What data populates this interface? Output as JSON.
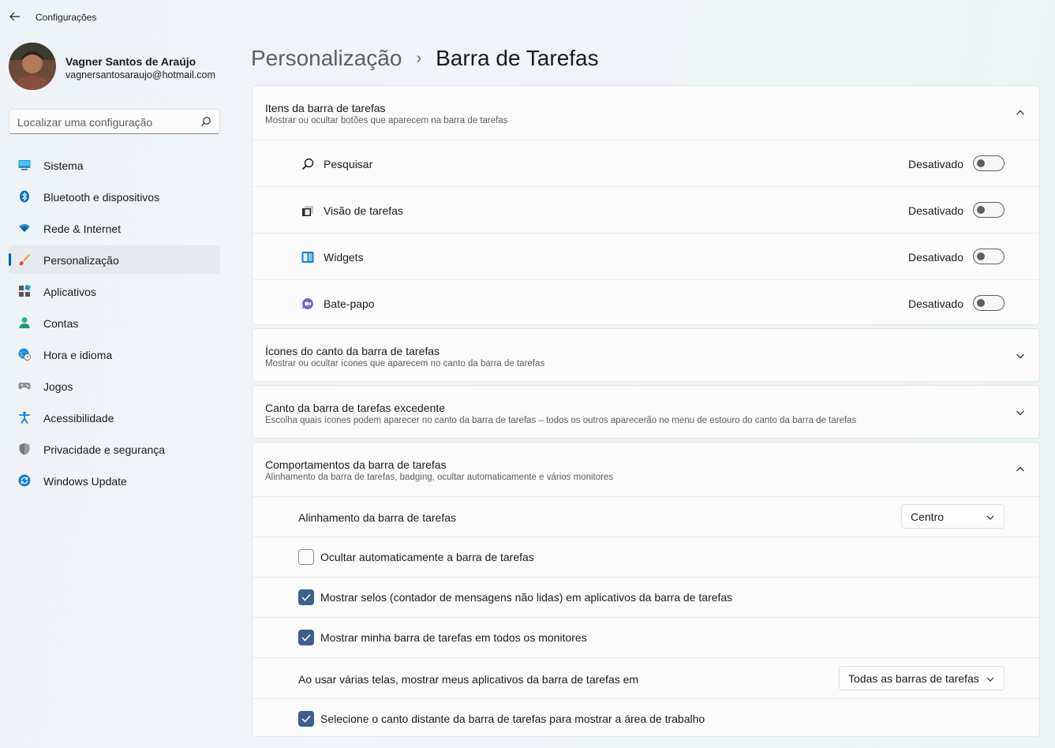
{
  "app": {
    "title": "Configurações"
  },
  "profile": {
    "name": "Vagner Santos de Araújo",
    "email": "vagnersantosaraujo@hotmail.com"
  },
  "search": {
    "placeholder": "Localizar uma configuração"
  },
  "nav": {
    "items": [
      {
        "label": "Sistema",
        "icon": "monitor-icon"
      },
      {
        "label": "Bluetooth e dispositivos",
        "icon": "bluetooth-icon"
      },
      {
        "label": "Rede & Internet",
        "icon": "wifi-icon"
      },
      {
        "label": "Personalização",
        "icon": "brush-icon",
        "selected": true
      },
      {
        "label": "Aplicativos",
        "icon": "apps-icon"
      },
      {
        "label": "Contas",
        "icon": "person-icon"
      },
      {
        "label": "Hora e idioma",
        "icon": "globe-clock-icon"
      },
      {
        "label": "Jogos",
        "icon": "gamepad-icon"
      },
      {
        "label": "Acessibilidade",
        "icon": "accessibility-icon"
      },
      {
        "label": "Privacidade e segurança",
        "icon": "shield-icon"
      },
      {
        "label": "Windows Update",
        "icon": "update-icon"
      }
    ]
  },
  "breadcrumb": {
    "parent": "Personalização",
    "separator": "›",
    "current": "Barra de Tarefas"
  },
  "taskbar_items": {
    "title": "Itens da barra de tarefas",
    "subtitle": "Mostrar ou ocultar botões que aparecem na barra de tarefas",
    "rows": [
      {
        "label": "Pesquisar",
        "state": "Desativado",
        "icon": "search-icon"
      },
      {
        "label": "Visão de tarefas",
        "state": "Desativado",
        "icon": "task-view-icon"
      },
      {
        "label": "Widgets",
        "state": "Desativado",
        "icon": "widgets-icon"
      },
      {
        "label": "Bate-papo",
        "state": "Desativado",
        "icon": "chat-icon"
      }
    ]
  },
  "corner_icons": {
    "title": "Ícones do canto da barra de tarefas",
    "subtitle": "Mostrar ou ocultar ícones que aparecem no canto da barra de tarefas"
  },
  "corner_overflow": {
    "title": "Canto da barra de tarefas excedente",
    "subtitle": "Escolha quais ícones podem aparecer no canto da barra de tarefas – todos os outros aparecerão no menu de estouro do canto da barra de tarefas"
  },
  "behaviors": {
    "title": "Comportamentos da barra de tarefas",
    "subtitle": "Alinhamento da barra de tarefas, badging, ocultar automaticamente e vários monitores",
    "alignment": {
      "label": "Alinhamento da barra de tarefas",
      "value": "Centro"
    },
    "autohide": {
      "label": "Ocultar automaticamente a barra de tarefas",
      "checked": false
    },
    "badges": {
      "label": "Mostrar selos (contador de mensagens não lidas) em aplicativos da barra de tarefas",
      "checked": true
    },
    "all_monitors": {
      "label": "Mostrar minha barra de tarefas em todos os monitores",
      "checked": true
    },
    "multi_display": {
      "label": "Ao usar várias telas, mostrar meus aplicativos da barra de tarefas em",
      "value": "Todas as barras de tarefas"
    },
    "far_corner": {
      "label": "Selecione o canto distante da barra de tarefas para mostrar a área de trabalho",
      "checked": true
    }
  },
  "colors": {
    "accent": "#005fb8",
    "checkbox": "#3e5f8a"
  }
}
